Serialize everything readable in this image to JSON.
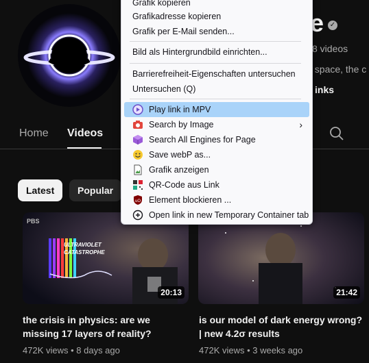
{
  "channel": {
    "name_fragment": "e",
    "videos_count": "8 videos",
    "description_fragment": "f space, the c",
    "links_fragment": "inks"
  },
  "tabs": [
    {
      "label": "Home",
      "active": false
    },
    {
      "label": "Videos",
      "active": true
    }
  ],
  "filters": [
    {
      "label": "Latest",
      "selected": true
    },
    {
      "label": "Popular",
      "selected": false
    }
  ],
  "videos": [
    {
      "title": "the crisis in physics: are we missing 17 layers of reality?",
      "views": "472K views",
      "age": "8 days ago",
      "duration": "20:13",
      "overlay_text": "ULTRAVIOLET CATASTROPHE",
      "watermark": "PBS"
    },
    {
      "title": "is our model of dark energy wrong? | new 4.2σ results",
      "views": "472K views",
      "age": "3 weeks ago",
      "duration": "21:42"
    }
  ],
  "context_menu": {
    "items": [
      {
        "label": "Grafik kopieren",
        "icon": null
      },
      {
        "label": "Grafikadresse kopieren",
        "icon": null
      },
      {
        "label": "Grafik per E-Mail senden...",
        "icon": null
      },
      {
        "separator": true
      },
      {
        "label": "Bild als Hintergrundbild einrichten...",
        "icon": null
      },
      {
        "separator": true
      },
      {
        "label": "Barrierefreiheit-Eigenschaften untersuchen",
        "icon": null
      },
      {
        "label": "Untersuchen (Q)",
        "icon": null
      },
      {
        "separator": true
      },
      {
        "label": "Play link in MPV",
        "icon": "mpv-play-icon",
        "highlighted": true
      },
      {
        "label": "Search by Image",
        "icon": "camera-icon",
        "submenu": true
      },
      {
        "label": "Search All Engines for Page",
        "icon": "cube-icon"
      },
      {
        "label": "Save webP as...",
        "icon": "smiley-icon"
      },
      {
        "label": "Grafik anzeigen",
        "icon": "image-file-icon"
      },
      {
        "label": "QR-Code aus Link",
        "icon": "qr-code-icon"
      },
      {
        "label": "Element blockieren ...",
        "icon": "ublock-shield-icon"
      },
      {
        "label": "Open link in new Temporary Container tab",
        "icon": "container-plus-icon"
      }
    ]
  },
  "colors": {
    "background": "#0f0f0f",
    "menu_background": "#f9f9fb",
    "menu_highlight": "#a9d3f9",
    "text_primary": "#f1f1f1",
    "text_secondary": "#aaaaaa"
  }
}
